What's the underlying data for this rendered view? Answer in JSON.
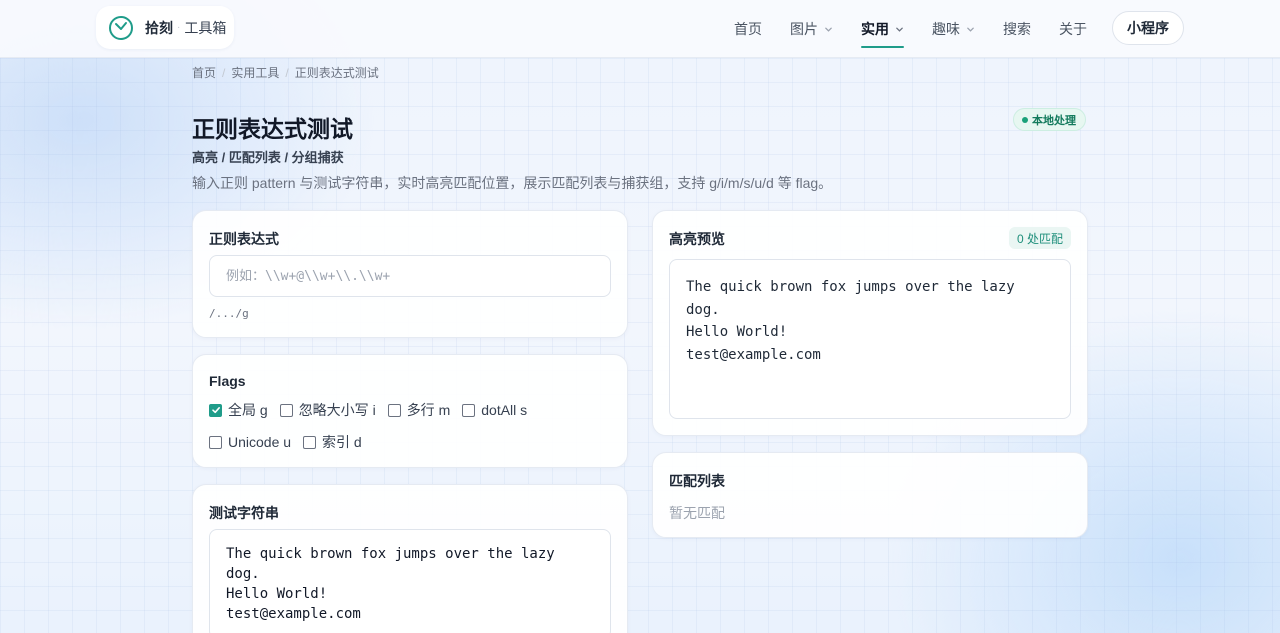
{
  "header": {
    "brand_name": "拾刻",
    "brand_separator": "·",
    "brand_sub": "工具箱",
    "logo_icon": "clock-icon",
    "nav": [
      {
        "label": "首页",
        "has_caret": false,
        "active": false
      },
      {
        "label": "图片",
        "has_caret": true,
        "active": false
      },
      {
        "label": "实用",
        "has_caret": true,
        "active": true
      },
      {
        "label": "趣味",
        "has_caret": true,
        "active": false
      },
      {
        "label": "搜索",
        "has_caret": false,
        "active": false
      },
      {
        "label": "关于",
        "has_caret": false,
        "active": false
      }
    ],
    "mini_program_label": "小程序"
  },
  "breadcrumb": {
    "items": [
      "首页",
      "实用工具",
      "正则表达式测试"
    ],
    "separator": "/"
  },
  "page": {
    "title": "正则表达式测试",
    "badge": "本地处理",
    "subtitle": "高亮 / 匹配列表 / 分组捕获",
    "description": "输入正则 pattern 与测试字符串，实时高亮匹配位置，展示匹配列表与捕获组，支持 g/i/m/s/u/d 等 flag。"
  },
  "regex": {
    "label": "正则表达式",
    "value": "",
    "placeholder": "例如：\\\\w+@\\\\w+\\\\.\\\\w+",
    "preview": "/.../g"
  },
  "flags": {
    "label": "Flags",
    "items": [
      {
        "label": "全局 g",
        "checked": true
      },
      {
        "label": "忽略大小写 i",
        "checked": false
      },
      {
        "label": "多行 m",
        "checked": false
      },
      {
        "label": "dotAll s",
        "checked": false
      },
      {
        "label": "Unicode u",
        "checked": false
      },
      {
        "label": "索引 d",
        "checked": false
      }
    ]
  },
  "test_string": {
    "label": "测试字符串",
    "value": "The quick brown fox jumps over the lazy\ndog.\nHello World!\ntest@example.com"
  },
  "highlight": {
    "label": "高亮预览",
    "match_count": "0 处匹配",
    "text": "The quick brown fox jumps over the lazy\ndog.\nHello World!\ntest@example.com"
  },
  "matches": {
    "label": "匹配列表",
    "empty_text": "暂无匹配"
  },
  "colors": {
    "accent": "#1f9c8a",
    "badge_text": "#137a5c",
    "badge_bg": "#e7f7f1"
  }
}
